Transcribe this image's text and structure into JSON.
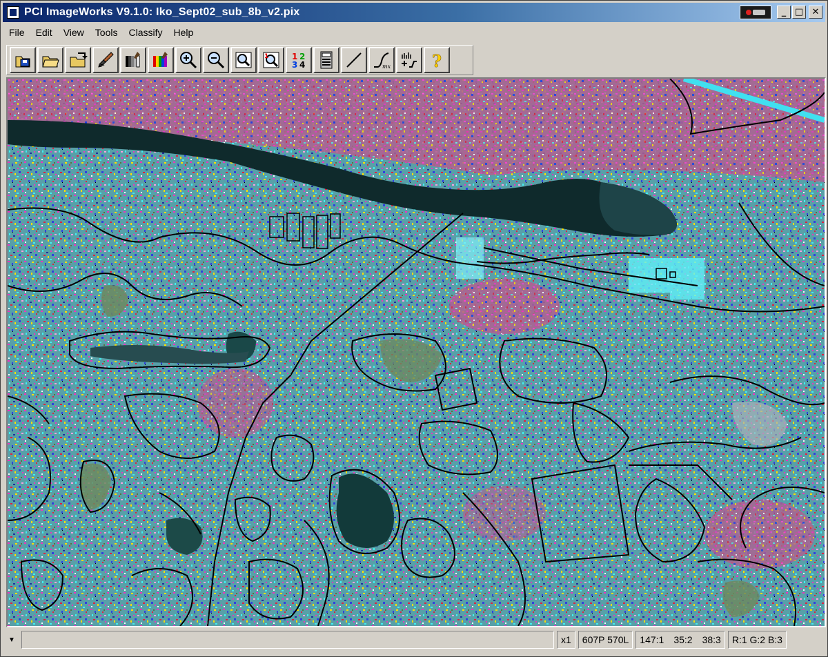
{
  "window": {
    "title": "PCI ImageWorks V9.1.0: Iko_Sept02_sub_8b_v2.pix",
    "controls": {
      "minimize": "_",
      "maximize": "□",
      "close": "✕"
    },
    "colors": {
      "titlebar_start": "#0a246a",
      "titlebar_end": "#a6caf0",
      "chrome": "#d4d0c8"
    }
  },
  "menu": [
    {
      "label": "File"
    },
    {
      "label": "Edit"
    },
    {
      "label": "View"
    },
    {
      "label": "Tools"
    },
    {
      "label": "Classify"
    },
    {
      "label": "Help"
    }
  ],
  "toolbar": {
    "tools": [
      {
        "icon": "save-file-icon"
      },
      {
        "icon": "open-folder-icon"
      },
      {
        "icon": "export-icon"
      },
      {
        "icon": "edit-brush-icon"
      },
      {
        "icon": "grayscale-lut-icon"
      },
      {
        "icon": "color-lut-icon"
      },
      {
        "icon": "zoom-in-icon"
      },
      {
        "icon": "zoom-out-icon"
      },
      {
        "icon": "zoom-fit-icon"
      },
      {
        "icon": "zoom-one-icon"
      },
      {
        "icon": "band-numbers-icon",
        "text": [
          "1",
          "2",
          "3",
          "4"
        ]
      },
      {
        "icon": "calculator-icon"
      },
      {
        "icon": "line-tool-icon"
      },
      {
        "icon": "enhancement-curve-icon",
        "text": "mx"
      },
      {
        "icon": "histogram-icon"
      },
      {
        "icon": "help-icon",
        "text": "?"
      }
    ]
  },
  "status": {
    "zoom": "x1",
    "position": "607P 570L",
    "values": [
      "147:1",
      "35:2",
      "38:3"
    ],
    "band_mapping": "R:1 G:2 B:3"
  }
}
